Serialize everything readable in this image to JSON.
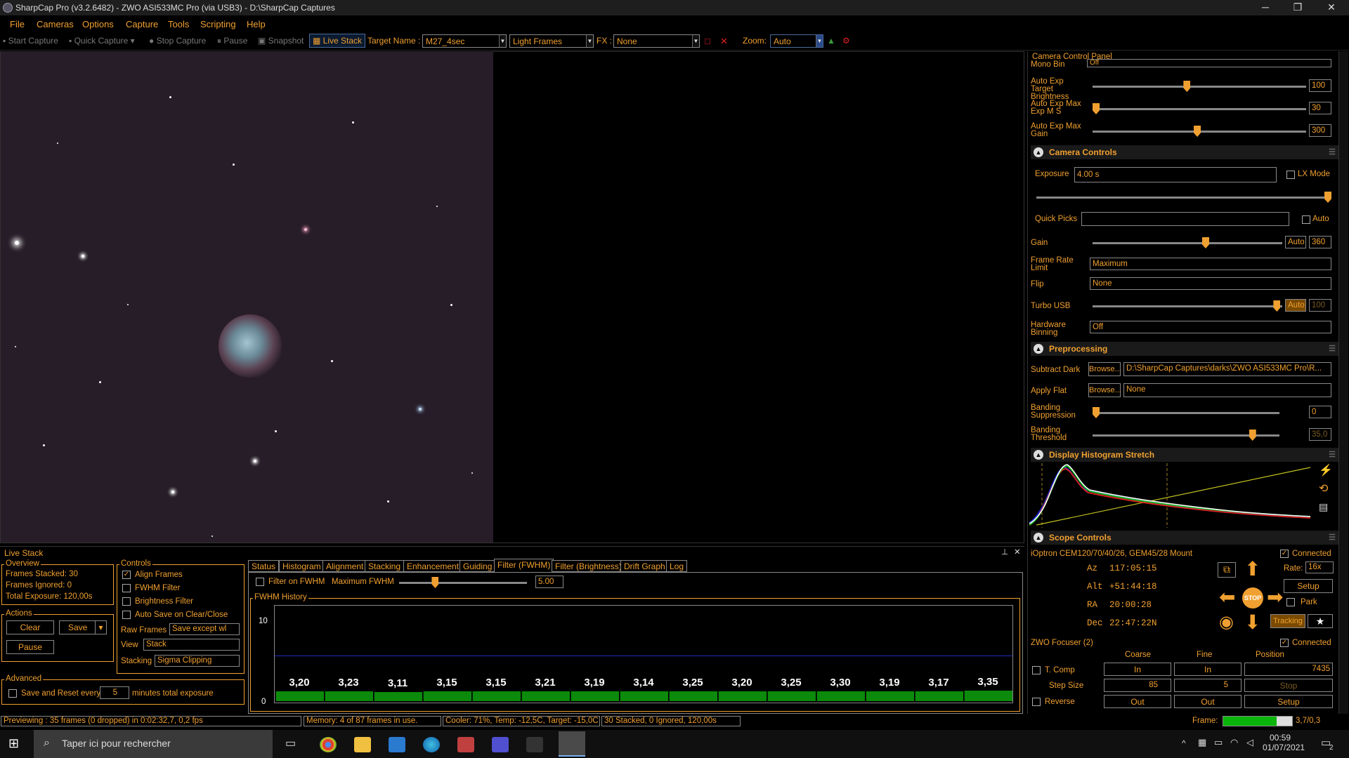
{
  "window": {
    "title": "SharpCap Pro (v3.2.6482) - ZWO ASI533MC Pro (via USB3) - D:\\SharpCap Captures",
    "min": "─",
    "max": "❐",
    "close": "✕"
  },
  "menu": [
    "File",
    "Cameras",
    "Options",
    "Capture",
    "Tools",
    "Scripting",
    "Help"
  ],
  "toolbar": {
    "start_capture": "Start Capture",
    "quick_capture": "Quick Capture",
    "stop_capture": "Stop Capture",
    "pause": "Pause",
    "snapshot": "Snapshot",
    "live_stack": "Live Stack",
    "target_label": "Target Name :",
    "target_value": "M27_4sec",
    "frame_type": "Light Frames",
    "fx_label": "FX :",
    "fx_value": "None",
    "zoom_label": "Zoom:",
    "zoom_value": "Auto"
  },
  "right_panel": {
    "title": "Camera Control Panel",
    "top_rows": [
      {
        "label": "Mono Bin",
        "value": "Off"
      },
      {
        "label": "Auto Exp Target Brightness",
        "value": "100",
        "pos": 0.44
      },
      {
        "label": "Auto Exp Max Exp M S",
        "value": "30",
        "pos": 0.0
      },
      {
        "label": "Auto Exp Max Gain",
        "value": "300",
        "pos": 0.49
      }
    ],
    "camera_controls": {
      "title": "Camera Controls",
      "exposure_label": "Exposure",
      "exposure_value": "4.00 s",
      "lx_mode": "LX Mode",
      "quick_picks": "Quick Picks",
      "auto": "Auto",
      "gain_label": "Gain",
      "gain_auto": "Auto",
      "gain_value": "360",
      "gain_pos": 0.6,
      "frame_rate_label": "Frame Rate Limit",
      "frame_rate_value": "Maximum",
      "flip_label": "Flip",
      "flip_value": "None",
      "turbo_label": "Turbo USB",
      "turbo_auto": "Auto",
      "turbo_value": "100",
      "turbo_pos": 0.99,
      "binning_label": "Hardware Binning",
      "binning_value": "Off"
    },
    "preprocessing": {
      "title": "Preprocessing",
      "subtract_dark": "Subtract Dark",
      "browse": "Browse...",
      "dark_value": "D:\\SharpCap Captures\\darks\\ZWO ASI533MC Pro\\R...",
      "apply_flat": "Apply Flat",
      "flat_value": "None",
      "banding_supp": "Banding Suppression",
      "banding_supp_value": "0",
      "banding_supp_pos": 0.0,
      "banding_thr": "Banding Threshold",
      "banding_thr_value": "35,0",
      "banding_thr_pos": 0.87
    },
    "histogram": {
      "title": "Display Histogram Stretch"
    },
    "scope": {
      "title": "Scope Controls",
      "mount": "iOptron CEM120/70/40/26, GEM45/28 Mount",
      "connected": "Connected",
      "az_label": "Az",
      "az": "117:05:15",
      "alt_label": "Alt",
      "alt": "+51:44:18",
      "ra_label": "RA",
      "ra": "20:00:28",
      "dec_label": "Dec",
      "dec": "22:47:22N",
      "rate_label": "Rate:",
      "rate": "16x",
      "setup": "Setup",
      "park": "Park",
      "tracking": "Tracking",
      "stop": "STOP"
    },
    "focuser": {
      "title": "ZWO Focuser (2)",
      "connected": "Connected",
      "coarse": "Coarse",
      "fine": "Fine",
      "position": "Position",
      "tcomp": "T. Comp",
      "in": "In",
      "pos_value": "7435",
      "step_size": "Step Size",
      "coarse_step": "85",
      "fine_step": "5",
      "stop": "Stop",
      "reverse": "Reverse",
      "out": "Out",
      "setup": "Setup"
    },
    "frame_label": "Frame:",
    "frame_value": "3,7/0,3",
    "frame_fill": 0.78
  },
  "live_stack": {
    "title": "Live Stack",
    "overview_title": "Overview",
    "frames_stacked": "Frames Stacked:  30",
    "frames_ignored": "Frames Ignored:   0",
    "total_exposure": "Total Exposure:   120,00s",
    "actions_title": "Actions",
    "clear": "Clear",
    "save": "Save",
    "pause": "Pause",
    "advanced_title": "Advanced",
    "save_reset": "Save and Reset every",
    "save_reset_value": "5",
    "save_reset_suffix": "minutes total exposure",
    "controls_title": "Controls",
    "align": "Align Frames",
    "fwhm_filter": "FWHM Filter",
    "brightness_filter": "Brightness Filter",
    "auto_save": "Auto Save on Clear/Close",
    "raw_frames_label": "Raw Frames",
    "raw_frames_value": "Save except wl",
    "view_label": "View",
    "view_value": "Stack",
    "stacking_label": "Stacking",
    "stacking_value": "Sigma Clipping",
    "tabs": [
      "Status",
      "Histogram",
      "Alignment",
      "Stacking",
      "Enhancement",
      "Guiding",
      "Filter (FWHM)",
      "Filter (Brightness)",
      "Drift Graph",
      "Log"
    ],
    "filter_on_fwhm": "Filter on FWHM",
    "max_fwhm_label": "Maximum FWHM",
    "max_fwhm_value": "5.00",
    "max_fwhm_pos": 0.27,
    "fwhm_history": "FWHM History"
  },
  "chart_data": {
    "type": "bar",
    "title": "FWHM History",
    "ylim": [
      0,
      10
    ],
    "yticks": [
      "10",
      "0"
    ],
    "values": [
      3.2,
      3.23,
      3.11,
      3.15,
      3.15,
      3.21,
      3.19,
      3.14,
      3.25,
      3.2,
      3.25,
      3.3,
      3.19,
      3.17,
      3.35
    ],
    "labels": [
      "3,20",
      "3,23",
      "3,11",
      "3,15",
      "3,15",
      "3,21",
      "3,19",
      "3,14",
      "3,25",
      "3,20",
      "3,25",
      "3,30",
      "3,19",
      "3,17",
      "3,35"
    ]
  },
  "status": {
    "preview": "Previewing : 35 frames (0 dropped) in 0:02:32,7, 0,2 fps",
    "memory": "Memory: 4 of 87 frames in use.",
    "cooler": "Cooler: 71%, Temp: -12,5C, Target: -15,0C",
    "stack": "30 Stacked, 0 Ignored, 120,00s"
  },
  "taskbar": {
    "search": "Taper ici pour rechercher",
    "time": "00:59",
    "date": "01/07/2021",
    "notif": "2"
  },
  "colors": {
    "accent": "#f0a030",
    "bar": "#0b8a0b",
    "bg": "#000000"
  }
}
